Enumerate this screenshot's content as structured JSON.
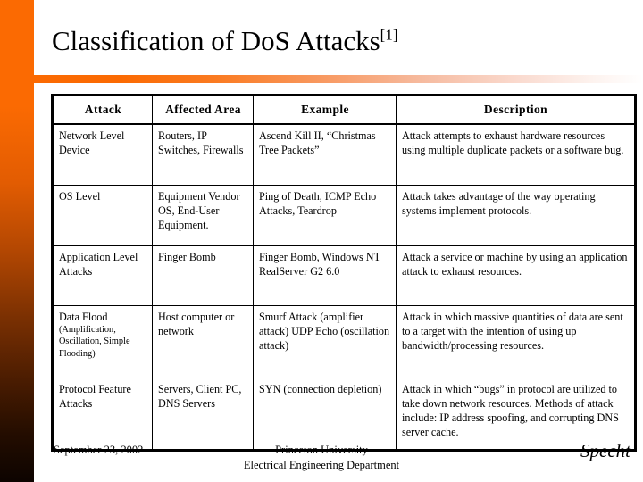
{
  "slide": {
    "title_text": "Classification of DoS Attacks",
    "title_superscript": "[1]",
    "accent_color": "#fb6a02",
    "accent_dark_color": "#0d0400"
  },
  "table": {
    "headers": [
      "Attack",
      "Affected Area",
      "Example",
      "Description"
    ],
    "rows": [
      {
        "attack": "Network Level Device",
        "attack_sub": "",
        "area": "Routers, IP Switches, Firewalls",
        "example": "Ascend Kill II, “Christmas Tree Packets”",
        "description": "Attack attempts to exhaust hardware resources using multiple duplicate packets or a software bug."
      },
      {
        "attack": "OS Level",
        "attack_sub": "",
        "area": "Equipment Vendor OS, End-User Equipment.",
        "example": "Ping of Death, ICMP Echo Attacks, Teardrop",
        "description": "Attack takes advantage of the way operating systems implement protocols."
      },
      {
        "attack": "Application Level Attacks",
        "attack_sub": "",
        "area": "Finger Bomb",
        "example": "Finger Bomb, Windows NT RealServer G2 6.0",
        "description": "Attack a service or machine by using an application attack to exhaust resources."
      },
      {
        "attack": "Data Flood",
        "attack_sub": "(Amplification, Oscillation, Simple Flooding)",
        "area": "Host computer or network",
        "example": "Smurf Attack (amplifier attack) UDP Echo (oscillation attack)",
        "description": "Attack in which massive quantities of data are sent to a target with the intention of using up bandwidth/processing resources."
      },
      {
        "attack": "Protocol Feature Attacks",
        "attack_sub": "",
        "area": "Servers, Client PC, DNS Servers",
        "example": "SYN (connection depletion)",
        "description": "Attack in which “bugs” in protocol are utilized to take down network resources. Methods of attack include:  IP address spoofing, and corrupting DNS server cache."
      }
    ]
  },
  "footer": {
    "date": "September 23, 2002",
    "org_line1": "Princeton University",
    "org_line2": "Electrical Engineering Department",
    "author": "Specht"
  }
}
